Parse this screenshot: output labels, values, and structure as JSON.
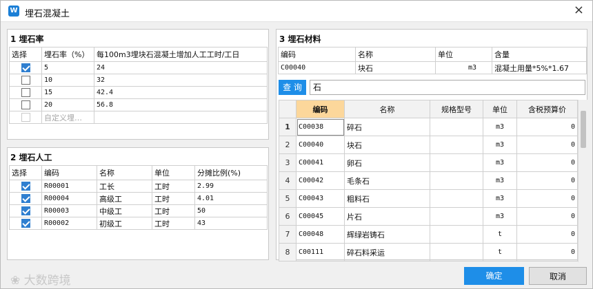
{
  "window": {
    "title": "埋石混凝土",
    "app_icon_text": "W",
    "close_glyph": "×"
  },
  "section1": {
    "title": "1 埋石率",
    "headers": [
      "选择",
      "埋石率（%）",
      "每100m3埋块石混凝土增加人工工时/工日"
    ],
    "rows": [
      {
        "checked": true,
        "rate": "5",
        "value": "24"
      },
      {
        "checked": false,
        "rate": "10",
        "value": "32"
      },
      {
        "checked": false,
        "rate": "15",
        "value": "42.4"
      },
      {
        "checked": false,
        "rate": "20",
        "value": "56.8"
      }
    ],
    "custom_placeholder": "自定义埋…"
  },
  "section2": {
    "title": "2 埋石人工",
    "headers": [
      "选择",
      "编码",
      "名称",
      "单位",
      "分摊比例(%)"
    ],
    "rows": [
      {
        "code": "R00001",
        "name": "工长",
        "unit": "工时",
        "ratio": "2.99"
      },
      {
        "code": "R00004",
        "name": "高级工",
        "unit": "工时",
        "ratio": "4.01"
      },
      {
        "code": "R00003",
        "name": "中级工",
        "unit": "工时",
        "ratio": "50"
      },
      {
        "code": "R00002",
        "name": "初级工",
        "unit": "工时",
        "ratio": "43"
      }
    ]
  },
  "section3": {
    "title": "3 埋石材料",
    "headers": [
      "编码",
      "名称",
      "单位",
      "含量"
    ],
    "row": {
      "code": "C00040",
      "name": "块石",
      "unit": "m3",
      "content": "混凝土用量*5%*1.67"
    }
  },
  "search": {
    "button": "查 询",
    "value": "石"
  },
  "grid": {
    "headers": [
      "",
      "编码",
      "名称",
      "规格型号",
      "单位",
      "含税预算价"
    ],
    "rows": [
      {
        "n": "1",
        "code": "C00038",
        "name": "碎石",
        "unit": "m3",
        "price": "0"
      },
      {
        "n": "2",
        "code": "C00040",
        "name": "块石",
        "unit": "m3",
        "price": "0"
      },
      {
        "n": "3",
        "code": "C00041",
        "name": "卵石",
        "unit": "m3",
        "price": "0"
      },
      {
        "n": "4",
        "code": "C00042",
        "name": "毛条石",
        "unit": "m3",
        "price": "0"
      },
      {
        "n": "5",
        "code": "C00043",
        "name": "粗料石",
        "unit": "m3",
        "price": "0"
      },
      {
        "n": "6",
        "code": "C00045",
        "name": "片石",
        "unit": "m3",
        "price": "0"
      },
      {
        "n": "7",
        "code": "C00048",
        "name": "辉绿岩铸石",
        "unit": "t",
        "price": "0"
      },
      {
        "n": "8",
        "code": "C00111",
        "name": "碎石料采运",
        "unit": "t",
        "price": "0"
      }
    ]
  },
  "buttons": {
    "ok": "确定",
    "cancel": "取消"
  },
  "watermark": "大数跨境",
  "colors": {
    "accent": "#1e8ee8",
    "check": "#2f7fd0"
  }
}
